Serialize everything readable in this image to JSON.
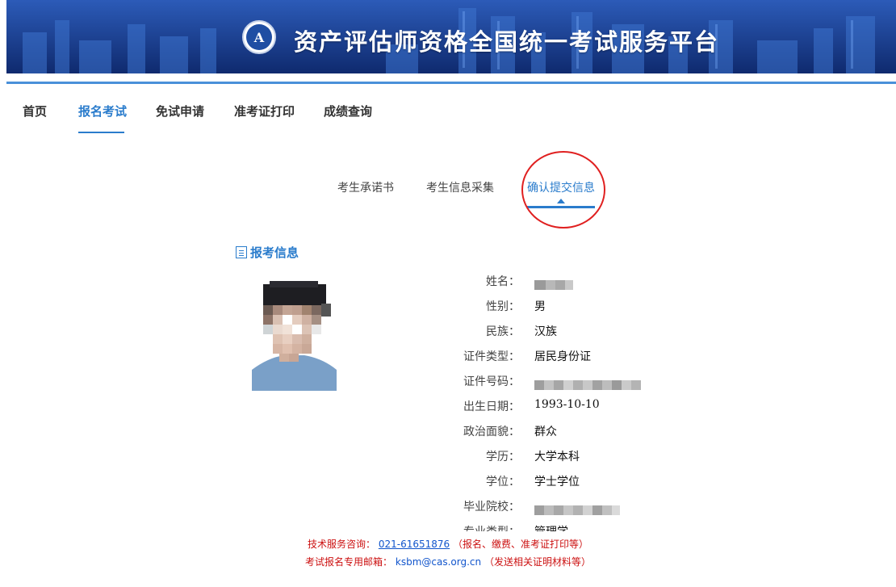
{
  "header": {
    "title": "资产评估师资格全国统一考试服务平台",
    "logo_letter": "A"
  },
  "nav": {
    "items": [
      "首页",
      "报名考试",
      "免试申请",
      "准考证打印",
      "成绩查询"
    ],
    "active": "报名考试"
  },
  "steps": {
    "items": [
      "考生承诺书",
      "考生信息采集",
      "确认提交信息"
    ],
    "active": "确认提交信息"
  },
  "section": {
    "title": "报考信息"
  },
  "info": [
    {
      "label": "姓名：",
      "value": ""
    },
    {
      "label": "性别：",
      "value": "男"
    },
    {
      "label": "民族：",
      "value": "汉族"
    },
    {
      "label": "证件类型：",
      "value": "居民身份证"
    },
    {
      "label": "证件号码：",
      "value": ""
    },
    {
      "label": "出生日期：",
      "value": "1993-10-10"
    },
    {
      "label": "政治面貌：",
      "value": "群众"
    },
    {
      "label": "学历：",
      "value": "大学本科"
    },
    {
      "label": "学位：",
      "value": "学士学位"
    },
    {
      "label": "毕业院校：",
      "value": ""
    },
    {
      "label": "专业类型：",
      "value": "管理学"
    }
  ],
  "footer": {
    "tech_label": "技术服务咨询：",
    "tech_phone": "021-61651876",
    "tech_note": "（报名、缴费、准考证打印等）",
    "mail_label": "考试报名专用邮箱：",
    "mail": "ksbm@cas.org.cn",
    "mail_note": "（发送相关证明材料等）"
  },
  "colors": {
    "accent": "#2a7ccc",
    "banner": "#1d3f95",
    "highlight_circle": "#e02020",
    "footer_text": "#cc1111"
  }
}
